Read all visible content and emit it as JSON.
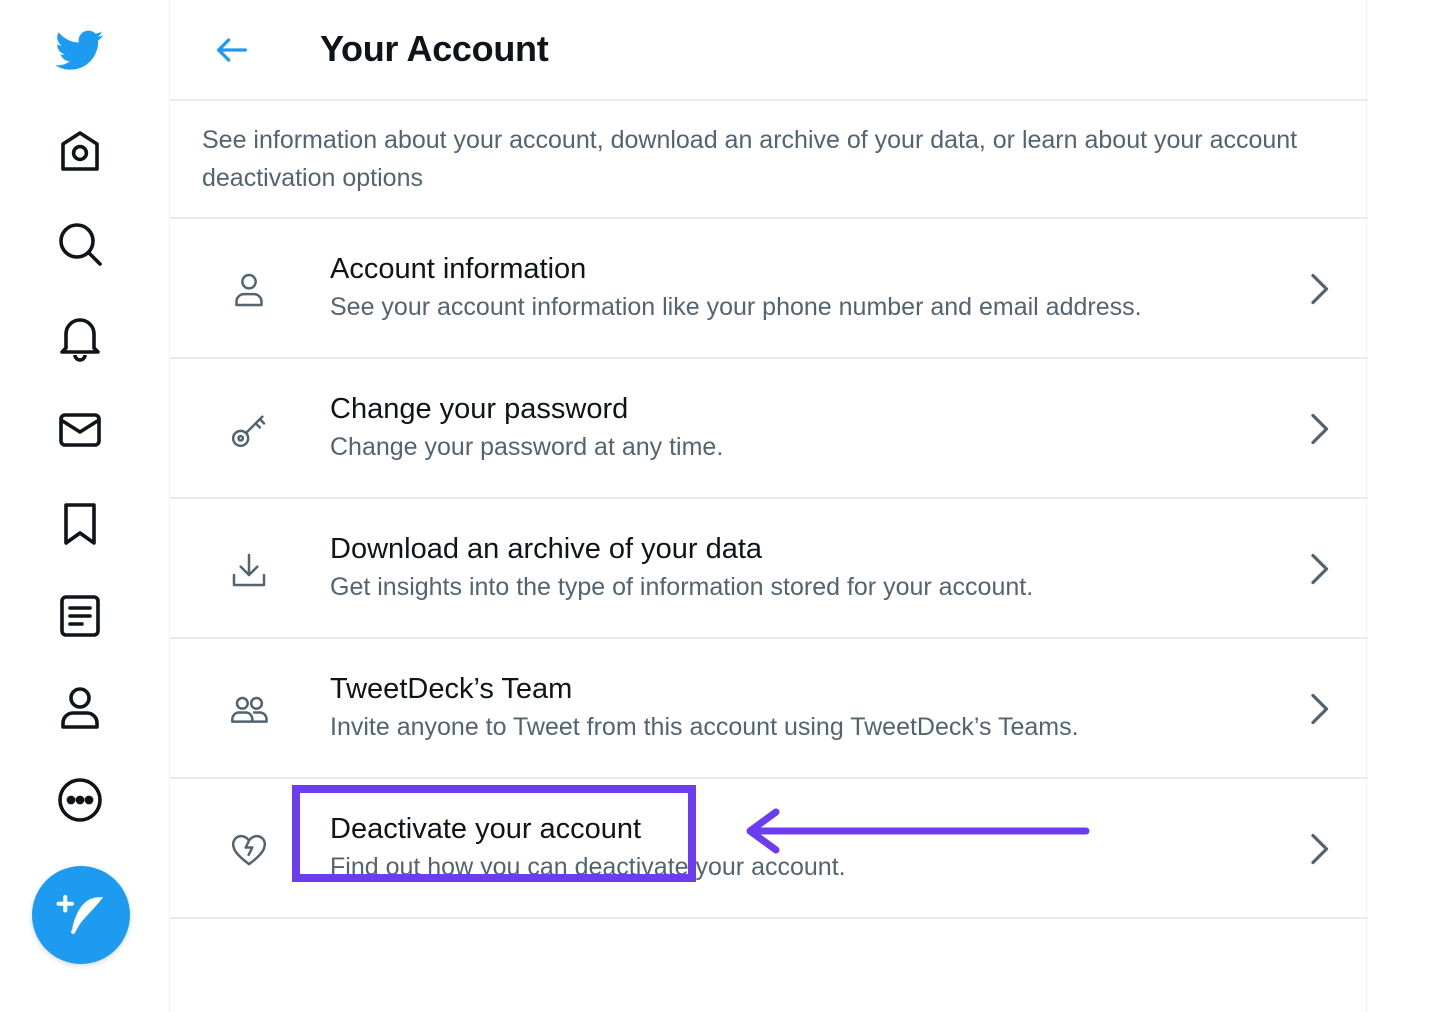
{
  "page": {
    "title": "Your Account",
    "intro": "See information about your account, download an archive of your data, or learn about your account deactivation options"
  },
  "sidebar": {
    "items": [
      {
        "icon": "twitter-logo-icon"
      },
      {
        "icon": "home-icon"
      },
      {
        "icon": "search-icon"
      },
      {
        "icon": "bell-icon"
      },
      {
        "icon": "mail-icon"
      },
      {
        "icon": "bookmark-icon"
      },
      {
        "icon": "list-icon"
      },
      {
        "icon": "profile-icon"
      },
      {
        "icon": "more-icon"
      }
    ],
    "compose_icon": "compose-tweet-icon"
  },
  "menu": [
    {
      "title": "Account information",
      "desc": "See your account information like your phone number and email address.",
      "icon": "person-icon"
    },
    {
      "title": "Change your password",
      "desc": "Change your password at any time.",
      "icon": "key-icon"
    },
    {
      "title": "Download an archive of your data",
      "desc": "Get insights into the type of information stored for your account.",
      "icon": "download-icon"
    },
    {
      "title": "TweetDeck’s Team",
      "desc": "Invite anyone to Tweet from this account using TweetDeck’s Teams.",
      "icon": "people-icon"
    },
    {
      "title": "Deactivate your account",
      "desc": "Find out how you can deactivate your account.",
      "icon": "broken-heart-icon"
    }
  ],
  "colors": {
    "accent": "#1d9bf0",
    "annotation": "#6b3cf0",
    "secondary_text": "#536471"
  }
}
